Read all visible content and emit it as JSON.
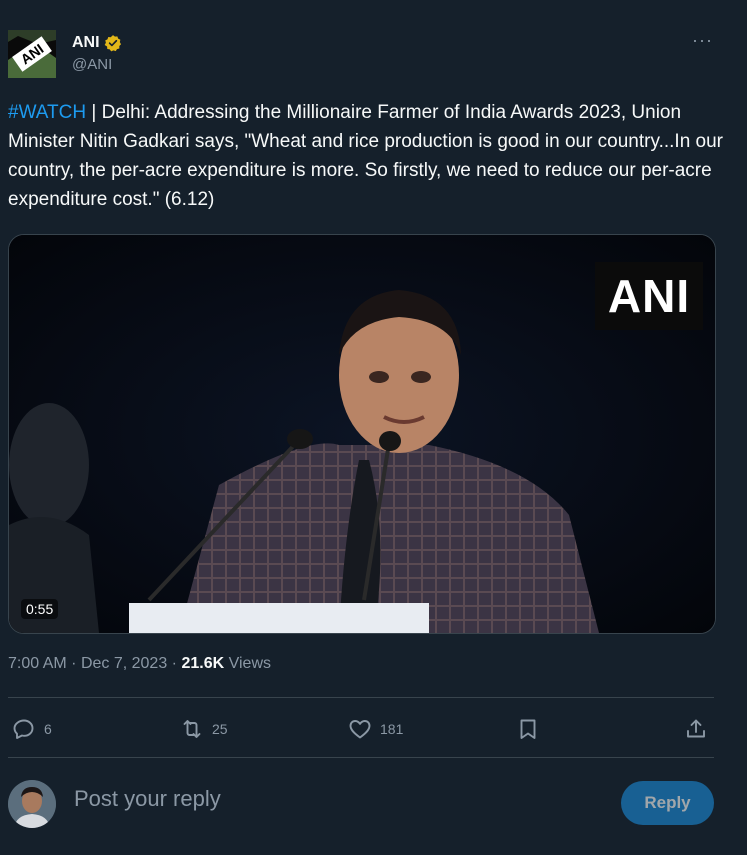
{
  "author": {
    "name": "ANI",
    "handle": "@ANI",
    "logo_text": "ANI"
  },
  "more_label": "···",
  "tweet": {
    "hashtag": "#WATCH",
    "body": " | Delhi: Addressing the Millionaire Farmer of India Awards 2023, Union Minister Nitin Gadkari says, \"Wheat and rice production is good in our country...In our country, the per-acre expenditure is more. So firstly, we need to reduce our per-acre expenditure cost.\" (6.12)"
  },
  "media": {
    "watermark": "ANI",
    "duration": "0:55"
  },
  "meta": {
    "time": "7:00 AM",
    "date": "Dec 7, 2023",
    "views_count": "21.6K",
    "views_label": "Views"
  },
  "actions": {
    "replies": "6",
    "reposts": "25",
    "likes": "181"
  },
  "reply_box": {
    "placeholder": "Post your reply",
    "button_label": "Reply"
  },
  "colors": {
    "background": "#15202b",
    "accent": "#1d9bf0",
    "muted": "#8b98a5",
    "verified_badge": "#e2b719"
  }
}
